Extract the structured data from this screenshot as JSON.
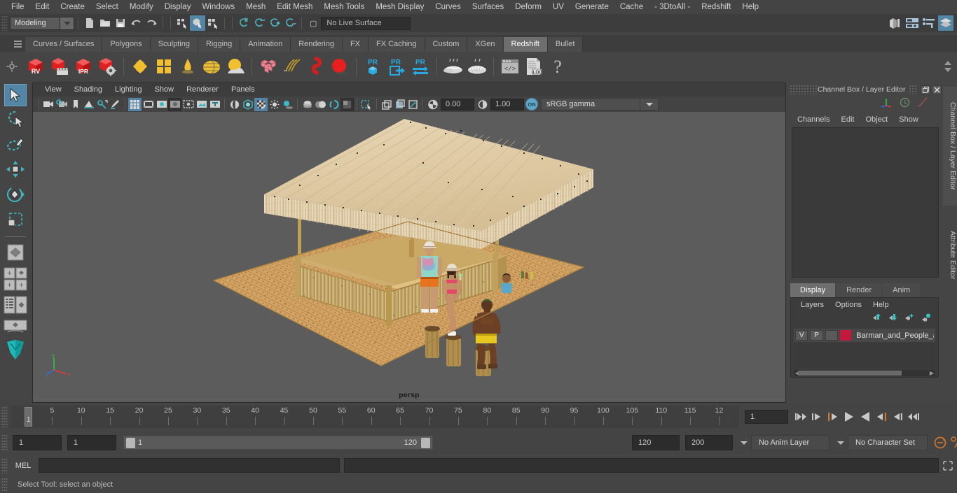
{
  "menubar": {
    "items": [
      "File",
      "Edit",
      "Create",
      "Select",
      "Modify",
      "Display",
      "Windows",
      "Mesh",
      "Edit Mesh",
      "Mesh Tools",
      "Mesh Display",
      "Curves",
      "Surfaces",
      "Deform",
      "UV",
      "Generate",
      "Cache",
      "- 3DtoAll -",
      "Redshift",
      "Help"
    ]
  },
  "statusline": {
    "menuset": "Modeling",
    "live_label": "No Live Surface",
    "icons": [
      "new-scene-icon",
      "open-scene-icon",
      "save-scene-icon",
      "undo-icon",
      "redo-icon",
      "select-hierarchy-icon",
      "select-object-icon",
      "select-component-icon",
      "snap-grid-icon",
      "snap-curve-icon",
      "snap-point-icon",
      "snap-projected-icon"
    ],
    "right_icons": [
      "show-hide-modeling-toolkit-icon",
      "show-hide-attribute-editor-icon",
      "show-hide-tool-settings-icon",
      "show-hide-channel-box-icon"
    ]
  },
  "shelf": {
    "tabs": [
      "Curves / Surfaces",
      "Polygons",
      "Sculpting",
      "Rigging",
      "Animation",
      "Rendering",
      "FX",
      "FX Caching",
      "Custom",
      "XGen",
      "Redshift",
      "Bullet"
    ],
    "active_tab": "Redshift",
    "icons": [
      "redshift-render-view-icon",
      "redshift-render-sequence-icon",
      "redshift-ipr-icon",
      "redshift-render-settings-icon",
      "redshift-material-icon",
      "redshift-material-blender-icon",
      "redshift-light-icon",
      "redshift-dome-light-icon",
      "redshift-environment-icon",
      "redshift-proxy-icon",
      "redshift-hair-icon",
      "redshift-volume-icon",
      "redshift-sphere-icon",
      "redshift-pr-cube-icon",
      "redshift-pr-export-icon",
      "redshift-pr-transfer-icon",
      "redshift-bake-icon",
      "redshift-bake-set-icon",
      "redshift-script-icon",
      "redshift-log-icon",
      "redshift-help-icon"
    ]
  },
  "toolbox": {
    "items": [
      "select-tool",
      "lasso-select-tool",
      "paint-select-tool",
      "move-tool",
      "rotate-tool",
      "scale-tool",
      "last-tool",
      "quick-layout-four-view",
      "quick-layout-panes",
      "quick-layout-outliner",
      "quick-layout-single",
      "maya-logo-icon"
    ],
    "active": "select-tool"
  },
  "viewport": {
    "menu": [
      "View",
      "Shading",
      "Lighting",
      "Show",
      "Renderer",
      "Panels"
    ],
    "toolbar_icons": [
      "select-camera-icon",
      "camera-attributes-icon",
      "bookmark-icon",
      "image-plane-icon",
      "2d-pan-zoom-icon",
      "grease-pencil-icon",
      "grid-icon",
      "film-gate-icon",
      "resolution-gate-icon",
      "gate-mask-icon",
      "field-chart-icon",
      "safe-action-icon",
      "safe-title-icon",
      "wireframe-icon",
      "smooth-shade-all-icon",
      "shade-textured-icon",
      "use-default-lighting-icon",
      "shadows-icon",
      "screen-space-ao-icon",
      "motion-blur-icon",
      "multisample-aa-icon",
      "depth-of-field-icon",
      "isolate-select-icon",
      "xray-icon",
      "xray-joints-icon",
      "xray-active-components-icon",
      "exposure-icon",
      "contrast-icon",
      "color-management-toggle-icon"
    ],
    "exposure_value": "0.00",
    "gamma_value": "1.00",
    "color_transform": "sRGB gamma",
    "camera_label": "persp",
    "axis": {
      "x": "x",
      "y": "y",
      "z": "z"
    }
  },
  "rightpanel": {
    "title": "Channel Box / Layer Editor",
    "window_buttons": [
      "undock-icon",
      "close-icon"
    ],
    "top_icons": [
      "axis-gizmo-icon",
      "clock-icon",
      "curve-icon"
    ],
    "channel_menu": [
      "Channels",
      "Edit",
      "Object",
      "Show"
    ],
    "editor_tabs": [
      "Display",
      "Render",
      "Anim"
    ],
    "active_editor_tab": "Display",
    "layer_menu": [
      "Layers",
      "Options",
      "Help"
    ],
    "layer_icons": [
      "move-layer-up-icon",
      "move-layer-down-icon",
      "new-layer-icon",
      "new-layer-from-selected-icon"
    ],
    "layers": [
      {
        "visibility": "V",
        "playback": "P",
        "shading": "",
        "color": "#c4183c",
        "name": "Barman_and_People_a"
      }
    ],
    "side_tabs": [
      "Channel Box / Layer Editor",
      "Attribute Editor"
    ]
  },
  "timeslider": {
    "tick_labels": [
      "5",
      "10",
      "15",
      "20",
      "25",
      "30",
      "35",
      "40",
      "45",
      "50",
      "55",
      "60",
      "65",
      "70",
      "75",
      "80",
      "85",
      "90",
      "95",
      "100",
      "105",
      "110",
      "115",
      "12"
    ],
    "current_frame": "1",
    "current_frame_field": "1",
    "playback_buttons": [
      "go-to-start-icon",
      "step-back-keyframe-icon",
      "step-back-frame-icon",
      "play-backwards-icon",
      "play-forwards-icon",
      "step-forward-frame-icon",
      "step-forward-keyframe-icon",
      "go-to-end-icon"
    ]
  },
  "rangebar": {
    "anim_start": "1",
    "range_start": "1",
    "range_slider_start": "1",
    "range_slider_end": "120",
    "range_end": "120",
    "anim_end": "200",
    "anim_layer": "No Anim Layer",
    "character_set": "No Character Set",
    "icons": [
      "auto-keyframe-icon",
      "animation-preferences-icon"
    ]
  },
  "mel": {
    "label": "MEL",
    "command_value": "",
    "output_value": "",
    "expand_icon": "expand-script-editor-icon"
  },
  "helpline": {
    "text": "Select Tool: select an object"
  },
  "colors": {
    "accent_blue": "#5285a6",
    "layer_red": "#c4183c",
    "background": "#444444",
    "viewport_bg": "#5c5c5c",
    "orange": "#d1762c"
  }
}
